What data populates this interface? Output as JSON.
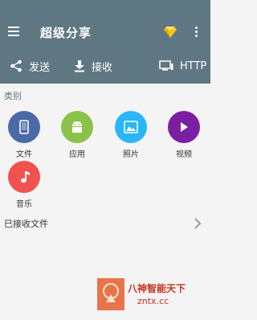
{
  "header": {
    "title": "超级分享",
    "menu_icon": "menu-icon",
    "premium_icon": "diamond-icon",
    "more_icon": "more-vert-icon",
    "bar_color": "#5f7782",
    "gem_color": "#f5c518"
  },
  "actions": [
    {
      "label": "发送",
      "icon": "share-icon"
    },
    {
      "label": "接收",
      "icon": "download-icon"
    },
    {
      "label": "HTTP",
      "icon": "computer-icon"
    }
  ],
  "categories_section": {
    "title": "类别",
    "items": [
      {
        "label": "文件",
        "icon": "phone-file-icon",
        "color": "#4a6aa5"
      },
      {
        "label": "应用",
        "icon": "android-icon",
        "color": "#8bc34a"
      },
      {
        "label": "照片",
        "icon": "image-icon",
        "color": "#29b6f6"
      },
      {
        "label": "视频",
        "icon": "play-icon",
        "color": "#7b1fa2"
      },
      {
        "label": "音乐",
        "icon": "music-note-icon",
        "color": "#ef5350"
      }
    ]
  },
  "received": {
    "label": "已接收文件",
    "icon": "chevron-right-icon"
  },
  "watermark": {
    "line1": "八神智能天下",
    "line2": "zntx.cc"
  }
}
